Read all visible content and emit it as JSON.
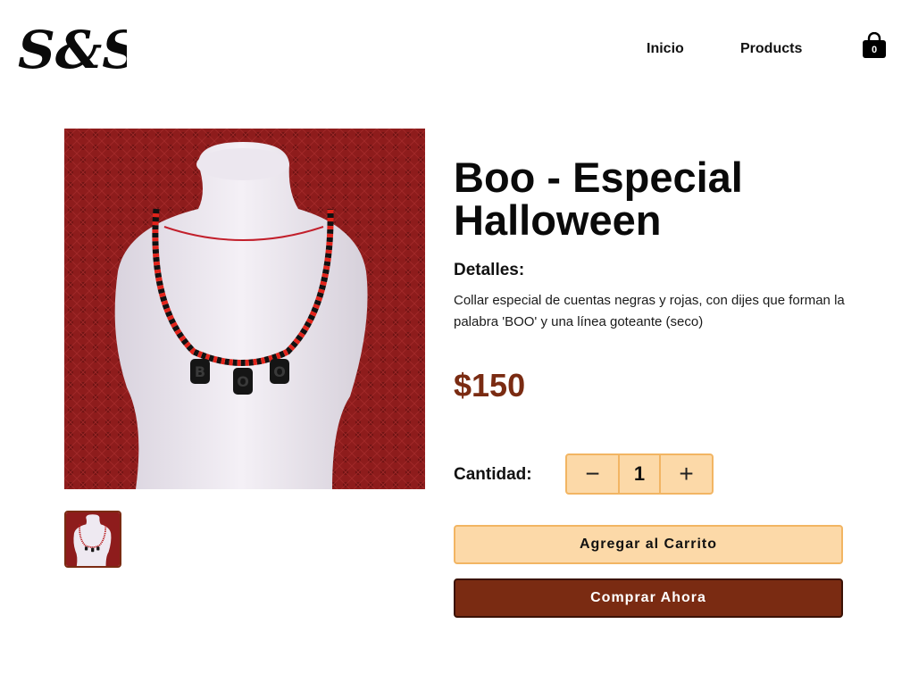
{
  "header": {
    "logo_text": "S&S",
    "nav": [
      {
        "label": "Inicio"
      },
      {
        "label": "Products"
      }
    ],
    "cart_count": "0",
    "cart_icon": "shopping-bag-icon"
  },
  "product": {
    "title": "Boo - Especial Halloween",
    "details_heading": "Detalles:",
    "description": "Collar especial de cuentas negras y rojas, con dijes que forman la palabra 'BOO' y una línea goteante (seco)",
    "price": "$150",
    "quantity_label": "Cantidad:",
    "quantity": "1",
    "decrement_symbol": "−",
    "increment_symbol": "+",
    "add_to_cart_label": "Agregar al Carrito",
    "buy_now_label": "Comprar Ahora",
    "image_pendant_letters": [
      "B",
      "O",
      "O"
    ]
  },
  "colors": {
    "accent_brown": "#7a2b12",
    "peach": "#fcd9a8",
    "peach_border": "#f2b563",
    "backdrop_red": "#8e1c1c"
  }
}
